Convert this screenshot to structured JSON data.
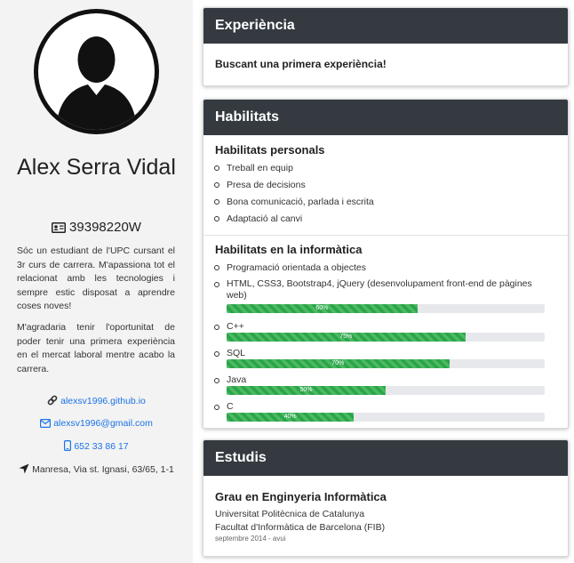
{
  "profile": {
    "name": "Alex Serra Vidal",
    "dni": "39398220W",
    "bio": [
      "Sóc un estudiant de l'UPC cursant el 3r curs de carrera. M'apassiona tot el relacionat amb les tecnologies i sempre estic disposat a aprendre coses noves!",
      "M'agradaria tenir l'oportunitat de poder tenir una primera experiència en el mercat laboral mentre acabo la carrera."
    ],
    "contacts": {
      "website": "alexsv1996.github.io",
      "email": "alexsv1996@gmail.com",
      "phone": "652 33 86 17",
      "address": "Manresa, Via st. Ignasi, 63/65, 1-1"
    }
  },
  "experience": {
    "title": "Experiència",
    "text": "Buscant una primera experiència!"
  },
  "skills": {
    "title": "Habilitats",
    "personal_title": "Habilitats personals",
    "personal": [
      "Treball en equip",
      "Presa de decisions",
      "Bona comunicació, parlada i escrita",
      "Adaptació al canvi"
    ],
    "tech_title": "Habilitats en la informàtica",
    "tech_text": [
      "Programació orientada a objectes",
      "HTML, CSS3, Bootstrap4, jQuery (desenvolupament front-end de pàgines web)"
    ],
    "bars": [
      {
        "name": "",
        "value": 60,
        "label": "60%"
      },
      {
        "name": "C++",
        "value": 75,
        "label": "75%"
      },
      {
        "name": "SQL",
        "value": 70,
        "label": "70%"
      },
      {
        "name": "Java",
        "value": 50,
        "label": "50%"
      },
      {
        "name": "C",
        "value": 40,
        "label": "40%"
      }
    ]
  },
  "studies": {
    "title": "Estudis",
    "degree": "Grau en Enginyeria Informàtica",
    "university": "Universitat Politècnica de Catalunya",
    "faculty": "Facultat d'Informàtica de Barcelona (FIB)",
    "dates": "septembre 2014 - avui"
  },
  "colors": {
    "header": "#343a40",
    "bar": "#28a745",
    "link": "#1a73e8"
  }
}
